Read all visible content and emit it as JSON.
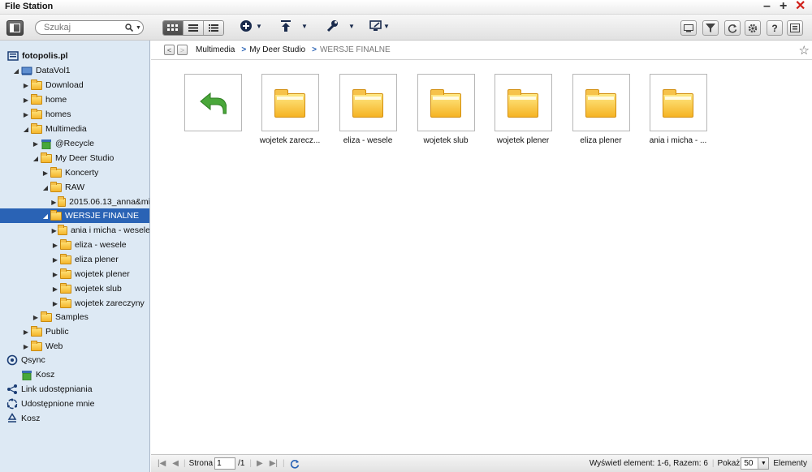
{
  "window": {
    "title": "File Station"
  },
  "colors": {
    "accent": "#2a63b5",
    "folder": "#f5b324",
    "close": "#d0201a",
    "recycle_green": "#47a83a"
  },
  "toolbar": {
    "search_placeholder": "Szukaj",
    "icons": [
      "panel-icon",
      "grid-view-icon",
      "list-view-icon",
      "detail-view-icon",
      "add-icon",
      "upload-icon",
      "tools-icon",
      "share-icon",
      "screen-icon",
      "filter-icon",
      "refresh-icon",
      "settings-icon",
      "help-icon",
      "info-icon"
    ]
  },
  "sidebar": {
    "items": [
      {
        "label": "fotopolis.pl",
        "icon": "server-icon"
      },
      {
        "label": "DataVol1",
        "icon": "drive-icon"
      },
      {
        "label": "Download"
      },
      {
        "label": "home"
      },
      {
        "label": "homes"
      },
      {
        "label": "Multimedia"
      },
      {
        "label": "@Recycle"
      },
      {
        "label": "My Deer Studio"
      },
      {
        "label": "Koncerty"
      },
      {
        "label": "RAW"
      },
      {
        "label": "2015.06.13_anna&mi"
      },
      {
        "label": "WERSJE FINALNE"
      },
      {
        "label": "ania i micha - wesele"
      },
      {
        "label": "eliza - wesele"
      },
      {
        "label": "eliza plener"
      },
      {
        "label": "wojetek plener"
      },
      {
        "label": "wojetek slub"
      },
      {
        "label": "wojetek zareczyny"
      },
      {
        "label": "Samples"
      },
      {
        "label": "Public"
      },
      {
        "label": "Web"
      },
      {
        "label": "Qsync"
      },
      {
        "label": "Kosz"
      },
      {
        "label": "Link udostępniania"
      },
      {
        "label": "Udostępnione mnie"
      },
      {
        "label": "Kosz"
      }
    ]
  },
  "breadcrumb": {
    "items": [
      "Multimedia",
      "My Deer Studio",
      "WERSJE FINALNE"
    ]
  },
  "files": [
    {
      "name": "wojetek zarecz..."
    },
    {
      "name": "eliza - wesele"
    },
    {
      "name": "wojetek slub"
    },
    {
      "name": "wojetek plener"
    },
    {
      "name": "eliza plener"
    },
    {
      "name": "ania i micha - ..."
    }
  ],
  "status": {
    "page_label": "Strona",
    "page_value": "1",
    "page_total": "/1",
    "summary": "Wyświetl element: 1-6, Razem: 6",
    "show_label": "Pokaż",
    "show_value": "50",
    "items_label": "Elementy"
  }
}
